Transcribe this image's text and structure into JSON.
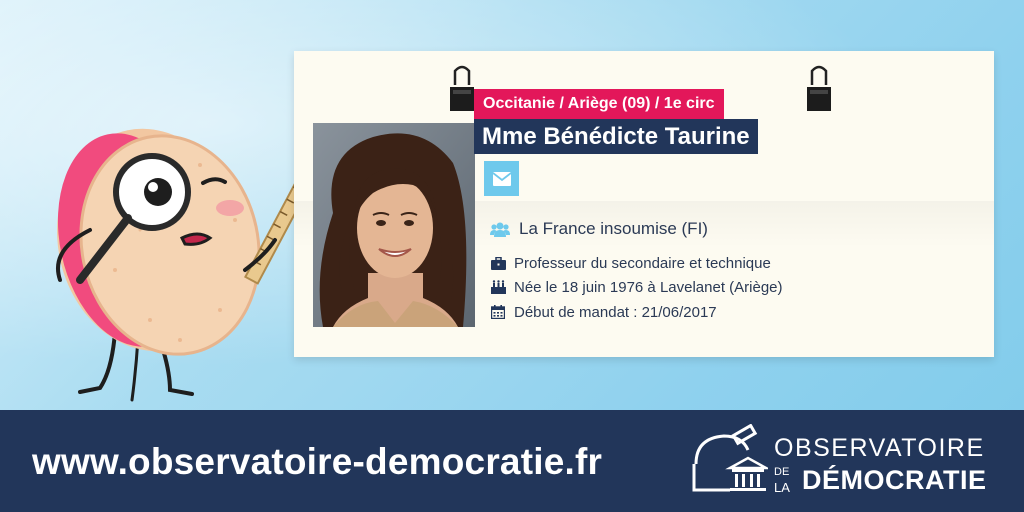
{
  "card": {
    "region": "Occitanie / Ariège (09) / 1e circ",
    "name": "Mme Bénédicte Taurine",
    "party": "La France insoumise (FI)",
    "profession": "Professeur du secondaire et technique",
    "birth": "Née le 18 juin 1976 à Lavelanet (Ariège)",
    "mandate_start": "Début de mandat : 21/06/2017"
  },
  "icons": {
    "mail": "envelope-icon",
    "party": "users-icon",
    "profession": "briefcase-icon",
    "birth": "birthday-cake-icon",
    "mandate": "calendar-icon"
  },
  "footer": {
    "url": "www.observatoire-democratie.fr",
    "logo_line1": "OBSERVATOIRE",
    "logo_de": "DE",
    "logo_la": "LA",
    "logo_line2": "DÉMOCRATIE"
  },
  "colors": {
    "accent_pink": "#e3175a",
    "navy": "#22365a",
    "light_blue": "#6ec9ec",
    "card_bg": "#fdfbf1"
  }
}
